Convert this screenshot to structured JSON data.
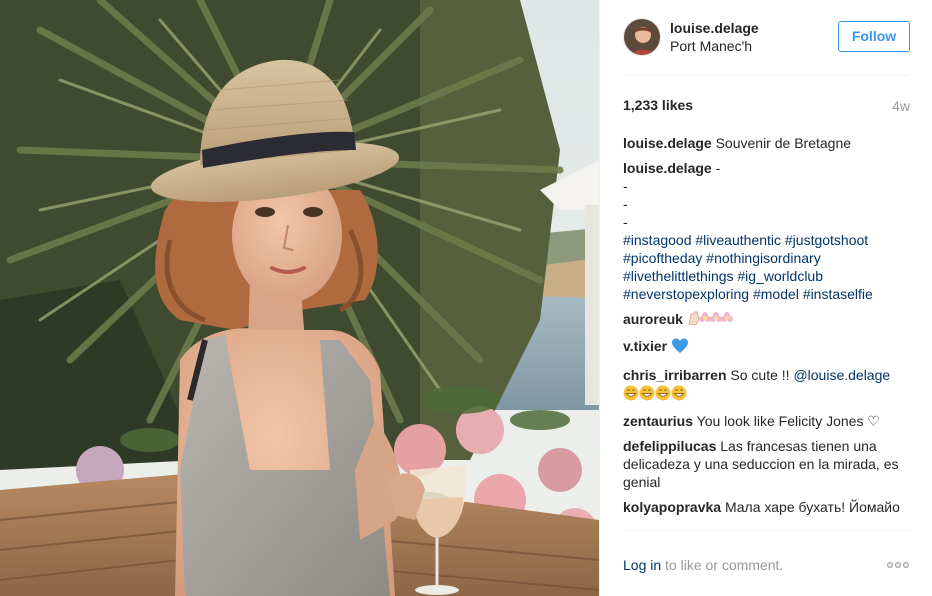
{
  "post": {
    "image_alt": "",
    "colors": {
      "link": "#003569",
      "follow": "#3897f0",
      "muted": "#999999"
    }
  },
  "header": {
    "username": "louise.delage",
    "location": "Port Manec'h",
    "follow_label": "Follow",
    "avatar_icon": "profile-photo"
  },
  "meta": {
    "likes": "1,233 likes",
    "age": "4w"
  },
  "caption": {
    "author": "louise.delage",
    "text": "Souvenir de Bretagne"
  },
  "second": {
    "author": "louise.delage",
    "text_first": "-",
    "dash_lines": [
      "-",
      "-",
      "-"
    ],
    "hashtag_lines": [
      "#instagood #liveauthentic #justgotshoot",
      "#picoftheday #nothingisordinary",
      "#livethelittlethings #ig_worldclub",
      "#neverstopexploring #model #instaselfie"
    ]
  },
  "comments": [
    {
      "author": "auroreuk",
      "text": "",
      "emoji": "clap-and-flowers-emoji"
    },
    {
      "author": "v.tixier",
      "text": "",
      "emoji": "blue-heart-emoji"
    },
    {
      "author": "chris_irribarren",
      "text": "So cute !!",
      "mention": "@louise.delage",
      "emoji": "grinning-faces-emoji"
    },
    {
      "author": "zentaurius",
      "text": "You look like Felicity Jones ♡"
    },
    {
      "author": "defelippilucas",
      "text": "Las francesas tienen una delicadeza y una seduccion en la mirada, es genial"
    },
    {
      "author": "kolyapopravka",
      "text": "Мала харе бухать! Йомайо"
    }
  ],
  "footer": {
    "login_link": "Log in",
    "login_rest": " to like or comment.",
    "more_icon": "more-options-icon"
  }
}
